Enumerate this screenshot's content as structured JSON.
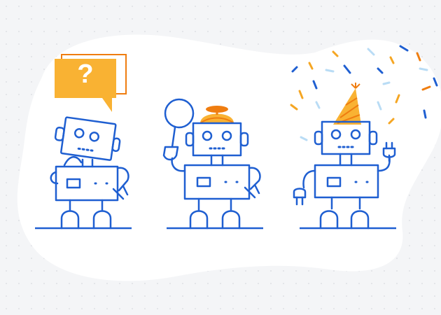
{
  "scene": {
    "speech_bubble": {
      "text": "?"
    },
    "colors": {
      "background": "#f4f5f7",
      "blob": "#ffffff",
      "robot_line": "#1f5fd1",
      "accent_orange": "#f5a623",
      "accent_orange_dark": "#ef7d10",
      "confetti_light": "#b9dcf5"
    },
    "robots": [
      {
        "name": "confused-robot",
        "prop": "question-speech-bubble"
      },
      {
        "name": "explorer-robot",
        "prop": "magnifying-glass-and-propeller-cap"
      },
      {
        "name": "party-robot",
        "prop": "party-hat-and-power-plug"
      }
    ]
  }
}
